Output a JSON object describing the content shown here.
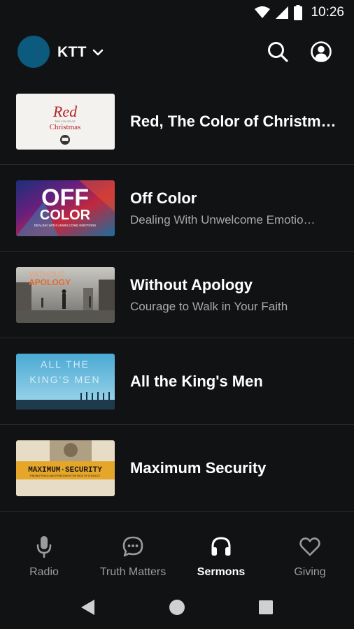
{
  "status_bar": {
    "time": "10:26"
  },
  "header": {
    "station_name": "KTT"
  },
  "series": [
    {
      "title": "Red, The Color of Christm…",
      "subtitle": "",
      "thumb": {
        "line1": "Red",
        "line2": "THE COLOR OF",
        "line3": "Christmas"
      }
    },
    {
      "title": "Off Color",
      "subtitle": "Dealing With Unwelcome Emotio…",
      "thumb": {
        "line1": "OFF",
        "line2": "COLOR",
        "line3": "DEALING WITH UNWELCOME EMOTIONS"
      }
    },
    {
      "title": "Without Apology",
      "subtitle": "Courage to Walk in Your Faith",
      "thumb": {
        "line1": "WITHOUT",
        "line2": "APOLOGY"
      }
    },
    {
      "title": "All the King's Men",
      "subtitle": "",
      "thumb": {
        "line1": "ALL THE",
        "line2": "KING'S MEN"
      }
    },
    {
      "title": "Maximum Security",
      "subtitle": "",
      "thumb": {
        "line1": "MAXIMUM·SECURITY",
        "line2": "FINDING PEACE AND FREEDOM IN THE FACE OF CONFLICT"
      }
    }
  ],
  "bottom_nav": {
    "tabs": [
      {
        "label": "Radio",
        "icon": "microphone-icon",
        "active": false
      },
      {
        "label": "Truth Matters",
        "icon": "chat-bubble-icon",
        "active": false
      },
      {
        "label": "Sermons",
        "icon": "headphones-icon",
        "active": true
      },
      {
        "label": "Giving",
        "icon": "heart-icon",
        "active": false
      }
    ]
  },
  "colors": {
    "background": "#111214",
    "avatar": "#0c5a7e",
    "divider": "#2a2b2e",
    "inactive_text": "#9a9b9e"
  }
}
